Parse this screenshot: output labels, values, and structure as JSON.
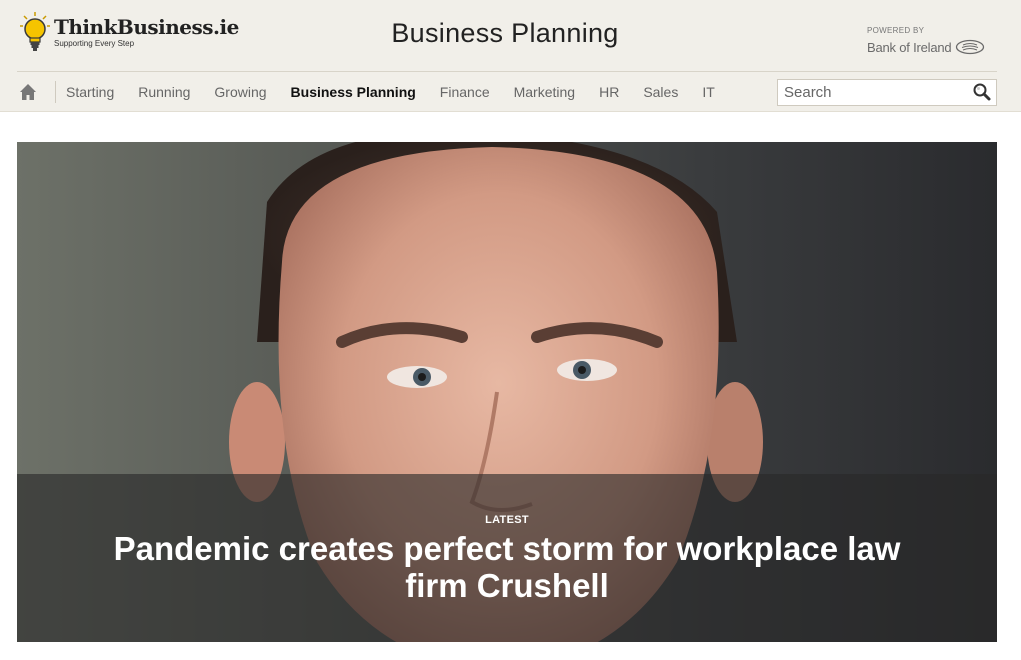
{
  "brand": {
    "name": "ThinkBusiness.ie",
    "tagline": "Supporting Every Step",
    "powered_by_label": "POWERED BY",
    "powered_by_brand": "Bank of Ireland"
  },
  "page": {
    "title": "Business Planning"
  },
  "nav": {
    "home_icon": "home-icon",
    "items": [
      {
        "label": "Starting",
        "active": false
      },
      {
        "label": "Running",
        "active": false
      },
      {
        "label": "Growing",
        "active": false
      },
      {
        "label": "Business Planning",
        "active": true
      },
      {
        "label": "Finance",
        "active": false
      },
      {
        "label": "Marketing",
        "active": false
      },
      {
        "label": "HR",
        "active": false
      },
      {
        "label": "Sales",
        "active": false
      },
      {
        "label": "IT",
        "active": false
      }
    ]
  },
  "search": {
    "placeholder": "Search",
    "icon": "search-icon"
  },
  "hero": {
    "badge": "LATEST",
    "headline": "Pandemic creates perfect storm for workplace law firm Crushell",
    "image": "portrait-photo"
  },
  "colors": {
    "header_bg": "#f1efe9",
    "bulb": "#f5c400",
    "text_dark": "#222222",
    "nav_text": "#666666"
  }
}
